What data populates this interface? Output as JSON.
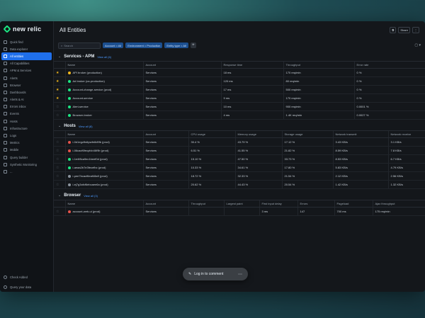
{
  "brand": {
    "name": "new relic"
  },
  "sidebar": {
    "items": [
      {
        "label": "Quick find",
        "active": false
      },
      {
        "label": "Data explorer",
        "active": false
      },
      {
        "label": "All entities",
        "active": true
      },
      {
        "label": "All Capabilities",
        "active": false
      },
      {
        "label": "APM & Services",
        "active": false
      },
      {
        "label": "Alerts",
        "active": false
      },
      {
        "label": "Browser",
        "active": false
      },
      {
        "label": "Dashboards",
        "active": false
      },
      {
        "label": "Alerts & AI",
        "active": false
      },
      {
        "label": "Errors inbox",
        "active": false
      },
      {
        "label": "Events",
        "active": false
      },
      {
        "label": "Hosts",
        "active": false
      },
      {
        "label": "Infrastructure",
        "active": false
      },
      {
        "label": "Logs",
        "active": false
      },
      {
        "label": "Metrics",
        "active": false
      },
      {
        "label": "Mobile",
        "active": false
      },
      {
        "label": "Query builder",
        "active": false
      },
      {
        "label": "Synthetic Monitoring",
        "active": false
      },
      {
        "label": "...",
        "active": false
      }
    ],
    "bottom": [
      "Check Added",
      "Query your data"
    ]
  },
  "header": {
    "title": "All Entities",
    "actions": [
      "⧉",
      "Share",
      "⋮"
    ]
  },
  "filters": {
    "search_placeholder": "Search",
    "chips": [
      "Account = All",
      "Environment = Production",
      "Entity type = All"
    ],
    "right_icon": "▢ ▾"
  },
  "apm": {
    "title": "Services - APM",
    "link": "View all (6)",
    "columns": [
      "",
      "Name",
      "Account",
      "Response time",
      "Throughput",
      "Error rate"
    ],
    "rows": [
      {
        "starred": true,
        "status": "#f2b81c",
        "name": "API broker (production)",
        "account": "Services",
        "resp": "18 ms",
        "thr": "170 req/min",
        "err": "0 %"
      },
      {
        "starred": true,
        "status": "#1ce783",
        "name": "Ad broker (ca-production)",
        "account": "Services",
        "resp": "120 ms",
        "thr": "80 req/min",
        "err": "0 %"
      },
      {
        "starred": true,
        "status": "#1ce783",
        "name": "Account-change-service (prod)",
        "account": "Services",
        "resp": "17 ms",
        "thr": "500 req/min",
        "err": "0 %"
      },
      {
        "starred": true,
        "status": "#1ce783",
        "name": "Account-service",
        "account": "Services",
        "resp": "9 ms",
        "thr": "170 req/min",
        "err": "0 %"
      },
      {
        "starred": false,
        "status": "#1ce783",
        "name": "Alert-service",
        "account": "Services",
        "resp": "10 ms",
        "thr": "900 req/min",
        "err": "0.0001 %"
      },
      {
        "starred": false,
        "status": "#1ce783",
        "name": "Browser-broker",
        "account": "Services",
        "resp": "4 ms",
        "thr": "1.4K req/min",
        "err": "0.0027 %"
      }
    ]
  },
  "hosts": {
    "title": "Hosts",
    "link": "View all (8)",
    "columns": [
      "",
      "Name",
      "Account",
      "CPU usage",
      "Memory usage",
      "Storage usage",
      "Network transmit",
      "Network receive"
    ],
    "rows": [
      {
        "starred": false,
        "status": "#e5534b",
        "name": "i-0d1egcfhdtpwfe8d9fb (prod)",
        "account": "Services",
        "cpu": "30.4 %",
        "mem": "43.79 %",
        "sto": "17.12 %",
        "tx": "3.43 KB/s",
        "rx": "3.1 KB/s"
      },
      {
        "starred": false,
        "status": "#e5534b",
        "name": "i-06cacf6fecpfcb46f9b (prod)",
        "account": "Services",
        "cpu": "6.51 %",
        "mem": "41.55 %",
        "sto": "21.82 %",
        "tx": "8.59 KB/s",
        "rx": "7.8 KB/s"
      },
      {
        "starred": false,
        "status": "#1ce783",
        "name": "i-1e4f8ca9ec1beef0d (prod)",
        "account": "Services",
        "cpu": "15.10 %",
        "mem": "47.50 %",
        "sto": "33.73 %",
        "tx": "8.53 KB/s",
        "rx": "6.7 KB/s"
      },
      {
        "starred": false,
        "status": "#1ce783",
        "name": "i-aeaa2b7e3fecefbc (prod)",
        "account": "Services",
        "cpu": "10.33 %",
        "mem": "34.61 %",
        "sto": "17.80 %",
        "tx": "5.83 KB/s",
        "rx": "4.79 KB/s"
      },
      {
        "starred": false,
        "status": "#8b949e",
        "name": "i-pee7bcacf6eaf48a9 (prod)",
        "account": "Services",
        "cpu": "18.72 %",
        "mem": "32.33 %",
        "sto": "21.54 %",
        "tx": "2.12 KB/s",
        "rx": "2.56 KB/s"
      },
      {
        "starred": false,
        "status": "#8b949e",
        "name": "i-ej7g3afcf6ebcaee6a (prod)",
        "account": "Services",
        "cpu": "20.62 %",
        "mem": "44.43 %",
        "sto": "20.54 %",
        "tx": "1.42 KB/s",
        "rx": "1.32 KB/s"
      }
    ]
  },
  "browser": {
    "title": "Browser",
    "link": "View all (3)",
    "columns": [
      "",
      "Name",
      "Account",
      "Throughput",
      "Largest paint",
      "First input delay",
      "Errors",
      "Pageload",
      "Ajax throughput"
    ],
    "rows": [
      {
        "starred": false,
        "status": "#e5534b",
        "name": "account-web-ui (prod)",
        "account": "Services",
        "thr": "",
        "lcp": "",
        "fid": "3 ms",
        "err": "147",
        "pl": "700 ms",
        "ajax": "175 req/min"
      }
    ]
  },
  "toast": {
    "label": "Log in to comment",
    "more": "⋯"
  }
}
